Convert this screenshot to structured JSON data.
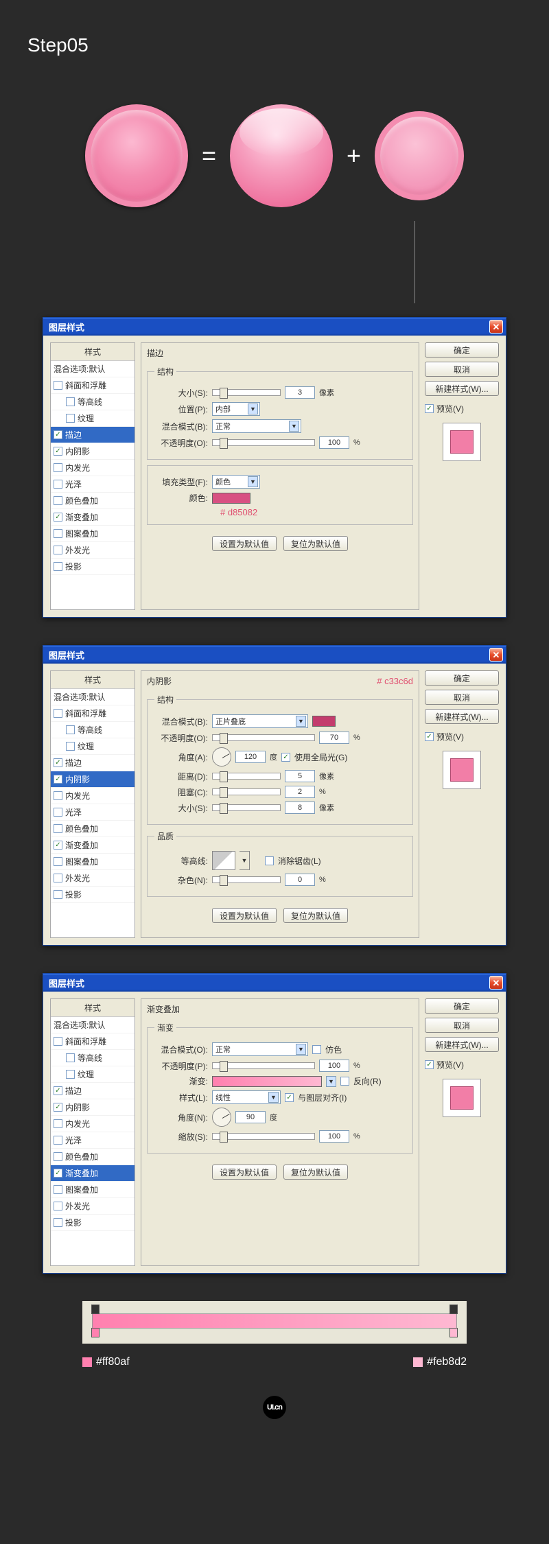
{
  "step_title": "Step05",
  "equals": "=",
  "plus": "+",
  "dialog_title": "图层样式",
  "styles_header": "样式",
  "styles": [
    {
      "label": "混合选项:默认",
      "checked": false,
      "indent": false
    },
    {
      "label": "斜面和浮雕",
      "checked": false,
      "indent": false
    },
    {
      "label": "等高线",
      "checked": false,
      "indent": true
    },
    {
      "label": "纹理",
      "checked": false,
      "indent": true
    },
    {
      "label": "描边",
      "checked": true,
      "indent": false
    },
    {
      "label": "内阴影",
      "checked": true,
      "indent": false
    },
    {
      "label": "内发光",
      "checked": false,
      "indent": false
    },
    {
      "label": "光泽",
      "checked": false,
      "indent": false
    },
    {
      "label": "颜色叠加",
      "checked": false,
      "indent": false
    },
    {
      "label": "渐变叠加",
      "checked": true,
      "indent": false
    },
    {
      "label": "图案叠加",
      "checked": false,
      "indent": false
    },
    {
      "label": "外发光",
      "checked": false,
      "indent": false
    },
    {
      "label": "投影",
      "checked": false,
      "indent": false
    }
  ],
  "right": {
    "ok": "确定",
    "cancel": "取消",
    "new_style": "新建样式(W)...",
    "preview": "预览(V)"
  },
  "common_buttons": {
    "set_default": "设置为默认值",
    "reset_default": "复位为默认值"
  },
  "stroke": {
    "panel": "描边",
    "structure": "结构",
    "size": "大小(S):",
    "size_val": "3",
    "size_unit": "像素",
    "position": "位置(P):",
    "position_val": "内部",
    "blend": "混合模式(B):",
    "blend_val": "正常",
    "opacity": "不透明度(O):",
    "opacity_val": "100",
    "opacity_unit": "%",
    "filltype": "填充类型(F):",
    "filltype_val": "颜色",
    "color_label": "颜色:",
    "color_hex": "# d85082",
    "color_value": "#d85082"
  },
  "inner_shadow": {
    "panel": "内阴影",
    "annot": "# c33c6d",
    "annot_color": "#c33c6d",
    "structure": "结构",
    "blend": "混合模式(B):",
    "blend_val": "正片叠底",
    "opacity": "不透明度(O):",
    "opacity_val": "70",
    "opacity_unit": "%",
    "angle": "角度(A):",
    "angle_val": "120",
    "angle_unit": "度",
    "use_global": "使用全局光(G)",
    "distance": "距离(D):",
    "distance_val": "5",
    "distance_unit": "像素",
    "choke": "阻塞(C):",
    "choke_val": "2",
    "choke_unit": "%",
    "size": "大小(S):",
    "size_val": "8",
    "size_unit": "像素",
    "quality": "品质",
    "contour": "等高线:",
    "antialias": "消除锯齿(L)",
    "noise": "杂色(N):",
    "noise_val": "0",
    "noise_unit": "%"
  },
  "gradient_overlay": {
    "panel": "渐变叠加",
    "sub": "渐变",
    "blend": "混合模式(O):",
    "blend_val": "正常",
    "dither": "仿色",
    "opacity": "不透明度(P):",
    "opacity_val": "100",
    "opacity_unit": "%",
    "gradient": "渐变:",
    "reverse": "反向(R)",
    "style": "样式(L):",
    "style_val": "线性",
    "align": "与图层对齐(I)",
    "angle": "角度(N):",
    "angle_val": "90",
    "angle_unit": "度",
    "scale": "缩放(S):",
    "scale_val": "100",
    "scale_unit": "%"
  },
  "swatches": {
    "left_hex": "#ff80af",
    "right_hex": "#feb8d2"
  },
  "footer": "UI.cn"
}
